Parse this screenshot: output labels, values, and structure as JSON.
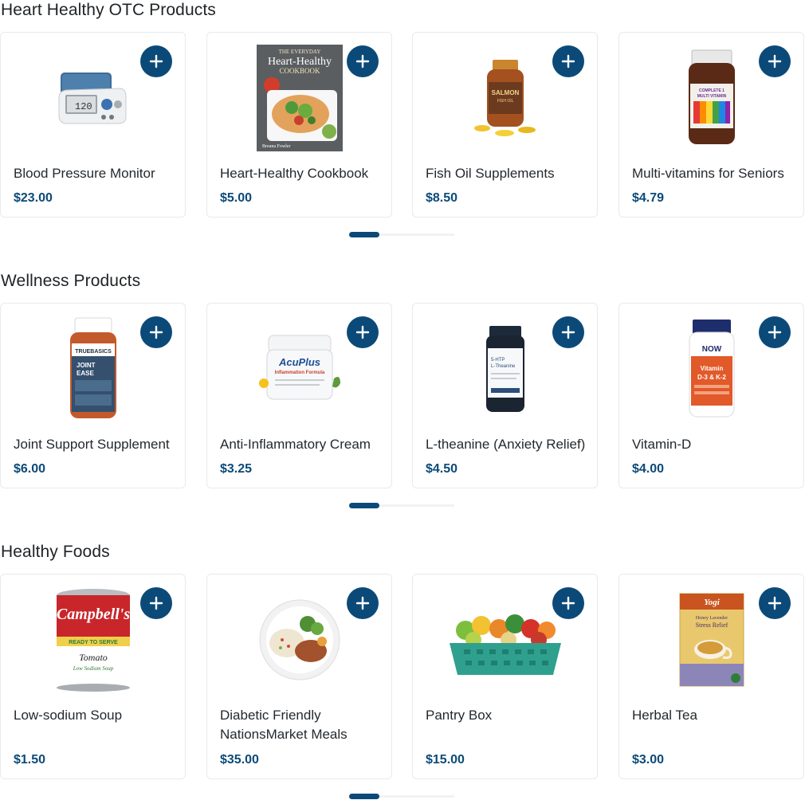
{
  "colors": {
    "accent": "#0b4a78",
    "card_border": "#e7eaee"
  },
  "add_icon": "plus-icon",
  "sections": [
    {
      "title": "Heart Healthy OTC Products",
      "products": [
        {
          "name": "Blood Pressure Monitor",
          "price": "$23.00",
          "image": "blood-pressure-monitor-image"
        },
        {
          "name": "Heart-Healthy Cookbook",
          "price": "$5.00",
          "image": "cookbook-image",
          "image_text": {
            "top": "THE EVERYDAY",
            "main": "Heart-Healthy",
            "sub": "COOKBOOK",
            "author": "Breana Fowler"
          }
        },
        {
          "name": "Fish Oil Supplements",
          "price": "$8.50",
          "image": "fish-oil-bottle-image",
          "image_text": {
            "label": "SALMON",
            "sub": "FISH OIL"
          }
        },
        {
          "name": "Multi-vitamins for Seniors",
          "price": "$4.79",
          "image": "multivitamin-bottle-image",
          "image_text": {
            "label": "COMPLETE 1 MULTI VITAMIN"
          }
        }
      ],
      "pager_index": 0
    },
    {
      "title": "Wellness Products",
      "products": [
        {
          "name": "Joint Support Supplement",
          "price": "$6.00",
          "image": "joint-ease-bottle-image",
          "image_text": {
            "brand": "TRUEBASICS",
            "label": "JOINT EASE"
          }
        },
        {
          "name": "Anti-Inflammatory Cream",
          "price": "$3.25",
          "image": "acuplus-cream-image",
          "image_text": {
            "brand": "AcuPlus",
            "label": "Inflammation Formula"
          }
        },
        {
          "name": "L-theanine (Anxiety Relief)",
          "price": "$4.50",
          "image": "l-theanine-bottle-image",
          "image_text": {
            "label": "5-HTP L-Theanine"
          }
        },
        {
          "name": "Vitamin-D",
          "price": "$4.00",
          "image": "vitamin-d-bottle-image",
          "image_text": {
            "brand": "NOW",
            "label": "Vitamin D-3 & K-2"
          }
        }
      ],
      "pager_index": 0
    },
    {
      "title": "Healthy Foods",
      "products": [
        {
          "name": "Low-sodium Soup",
          "price": "$1.50",
          "image": "soup-can-image",
          "image_text": {
            "brand": "Campbell's",
            "banner": "READY TO SERVE",
            "flavor": "Tomato",
            "sub": "Low Sodium Soup"
          }
        },
        {
          "name": "Diabetic Friendly NationsMarket Meals",
          "price": "$35.00",
          "image": "meal-plate-image"
        },
        {
          "name": "Pantry Box",
          "price": "$15.00",
          "image": "pantry-box-image"
        },
        {
          "name": "Herbal Tea",
          "price": "$3.00",
          "image": "herbal-tea-box-image",
          "image_text": {
            "brand": "Yogi",
            "label": "Honey Lavender Stress Relief"
          }
        }
      ],
      "pager_index": 0
    }
  ]
}
